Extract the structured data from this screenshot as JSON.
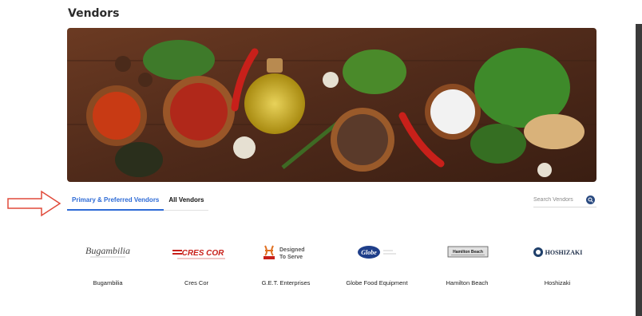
{
  "page": {
    "title": "Vendors"
  },
  "banner": {
    "alt": "Spices and herbs banner",
    "icon": "spices-banner-image"
  },
  "tabs": [
    {
      "label": "Primary & Preferred Vendors",
      "active": true
    },
    {
      "label": "All Vendors",
      "active": false
    }
  ],
  "search": {
    "placeholder": "Search Vendors",
    "icon": "search-icon"
  },
  "vendors": [
    {
      "name": "Bugambilia",
      "logo_text": "Bugambilia"
    },
    {
      "name": "Cres Cor",
      "logo_text": "CRES COR"
    },
    {
      "name": "G.E.T. Enterprises",
      "logo_text": "Designed To Serve"
    },
    {
      "name": "Globe Food Equipment",
      "logo_text": "Globe"
    },
    {
      "name": "Hamilton Beach",
      "logo_text": "Hamilton Beach"
    },
    {
      "name": "Hoshizaki",
      "logo_text": "HOSHIZAKI"
    }
  ],
  "colors": {
    "accent": "#2e6bd6",
    "annotation": "#e04a3a",
    "banner_wood": "#5a3220"
  }
}
